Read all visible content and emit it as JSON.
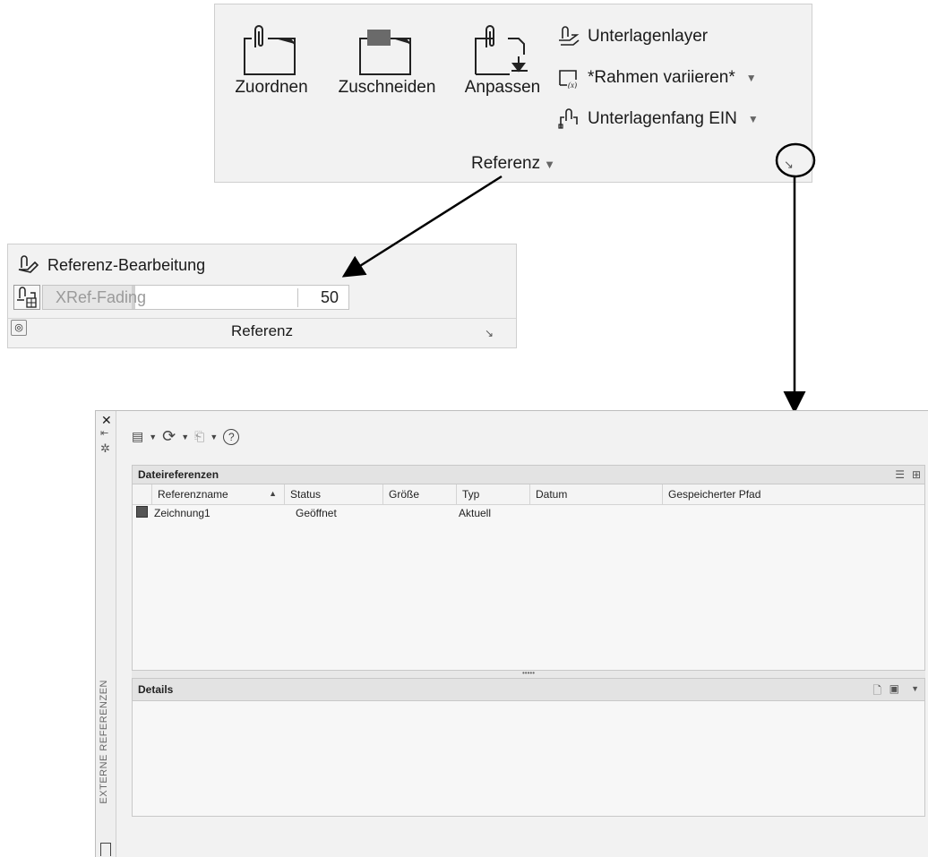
{
  "ribbon": {
    "buttons": {
      "attach": "Zuordnen",
      "clip": "Zuschneiden",
      "adjust": "Anpassen"
    },
    "small_buttons": {
      "underlay_layers": "Unterlagenlayer",
      "frames": "*Rahmen variieren*",
      "snap": "Unterlagenfang EIN"
    },
    "panel_title": "Referenz",
    "launcher_icon": "dialog-launcher-icon"
  },
  "compact_panel": {
    "edit_reference": "Referenz-Bearbeitung",
    "xref_fading_label": "XRef-Fading",
    "xref_fading_value": "50",
    "xref_fading_fraction": 0.35,
    "panel_title": "Referenz"
  },
  "palette": {
    "side_title": "EXTERNE REFERENZEN",
    "file_refs": {
      "title": "Dateireferenzen",
      "columns": [
        "Referenzname",
        "Status",
        "Größe",
        "Typ",
        "Datum",
        "Gespeicherter Pfad"
      ],
      "rows": [
        {
          "name": "Zeichnung1",
          "status": "Geöffnet",
          "size": "",
          "type": "Aktuell",
          "date": "",
          "path": ""
        }
      ]
    },
    "splitter": "•••••",
    "details": {
      "title": "Details"
    }
  },
  "colors": {
    "panel_bg": "#f2f2f2",
    "border": "#cfcfcf",
    "header_bg": "#e3e3e3"
  }
}
